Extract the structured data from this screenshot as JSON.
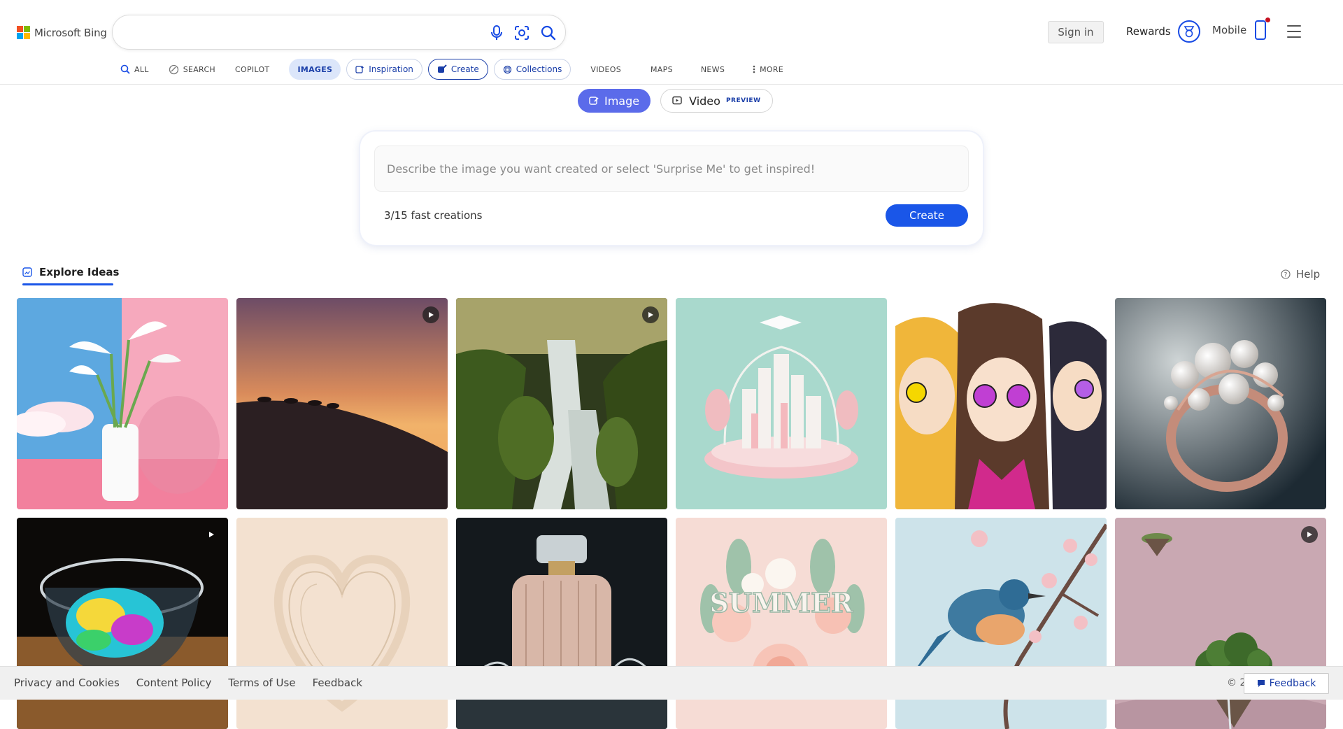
{
  "brand": {
    "name": "Microsoft Bing",
    "colors": {
      "red": "#f25022",
      "green": "#7fba00",
      "blue": "#00a4ef",
      "yellow": "#ffb900"
    }
  },
  "search": {
    "value": "",
    "icons": [
      "microphone-icon",
      "visual-search-icon",
      "search-icon"
    ]
  },
  "header": {
    "signin_label": "Sign in",
    "rewards_label": "Rewards",
    "mobile_label": "Mobile"
  },
  "nav": {
    "items": [
      {
        "label": "ALL",
        "icon": "search-icon"
      },
      {
        "label": "SEARCH",
        "icon": "copilot-search-icon"
      },
      {
        "label": "COPILOT"
      },
      {
        "label": "IMAGES",
        "active": true
      },
      {
        "label": "Inspiration",
        "icon": "sparkle-image-icon"
      },
      {
        "label": "Create",
        "icon": "brush-icon",
        "selected": true
      },
      {
        "label": "Collections",
        "icon": "collections-icon"
      },
      {
        "label": "VIDEOS"
      },
      {
        "label": "MAPS"
      },
      {
        "label": "NEWS"
      },
      {
        "label": "MORE",
        "icon": "more-vertical-icon"
      }
    ]
  },
  "mode": {
    "image_label": "Image",
    "video_label": "Video",
    "preview_label": "PREVIEW"
  },
  "prompt": {
    "placeholder": "Describe the image you want created or select 'Surprise Me' to get inspired!",
    "creations_text": "3/15 fast creations",
    "create_label": "Create"
  },
  "explore": {
    "tab_label": "Explore Ideas",
    "help_label": "Help",
    "tiles": [
      {
        "subject": "calla-lilies-pink-wall",
        "video": false
      },
      {
        "subject": "camels-desert-sunset",
        "video": true
      },
      {
        "subject": "forest-waterfall",
        "video": true
      },
      {
        "subject": "pastel-city-graduation",
        "video": false
      },
      {
        "subject": "anime-friends-sunglasses",
        "video": false
      },
      {
        "subject": "pearl-ring",
        "video": false
      },
      {
        "subject": "iridescent-glass",
        "video": true
      },
      {
        "subject": "paper-heart",
        "video": false
      },
      {
        "subject": "perfume-bottle-splash",
        "video": false
      },
      {
        "subject": "paper-summer-flowers",
        "video": false
      },
      {
        "subject": "bird-on-blossom-branch",
        "video": false
      },
      {
        "subject": "floating-island",
        "video": true
      }
    ]
  },
  "footer": {
    "links": [
      "Privacy and Cookies",
      "Content Policy",
      "Terms of Use",
      "Feedback"
    ],
    "copyright": "© 2",
    "feedback_button": "Feedback"
  }
}
